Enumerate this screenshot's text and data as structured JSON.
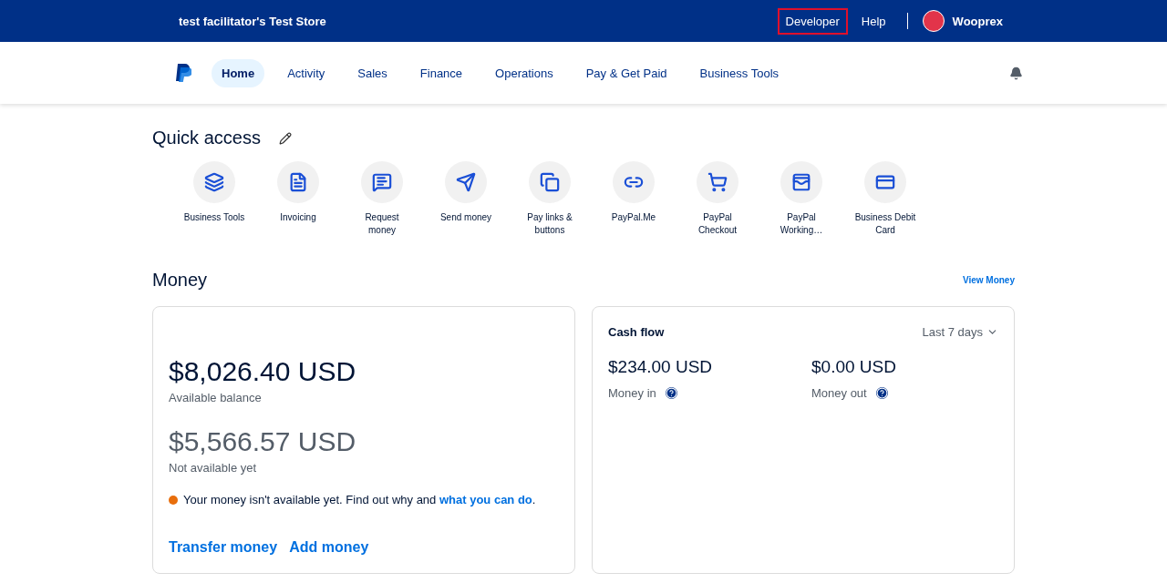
{
  "top_bar": {
    "store_name": "test facilitator's Test Store",
    "links": [
      {
        "label": "Developer",
        "highlighted": true
      },
      {
        "label": "Help",
        "highlighted": false
      }
    ],
    "user": "Wooprex"
  },
  "nav": {
    "items": [
      {
        "label": "Home",
        "selected": true
      },
      {
        "label": "Activity",
        "selected": false
      },
      {
        "label": "Sales",
        "selected": false
      },
      {
        "label": "Finance",
        "selected": false
      },
      {
        "label": "Operations",
        "selected": false
      },
      {
        "label": "Pay & Get Paid",
        "selected": false
      },
      {
        "label": "Business Tools",
        "selected": false
      }
    ]
  },
  "quick_access": {
    "title": "Quick access",
    "items": [
      {
        "label": "Business Tools"
      },
      {
        "label": "Invoicing"
      },
      {
        "label": "Request money"
      },
      {
        "label": "Send money"
      },
      {
        "label": "Pay links & buttons"
      },
      {
        "label": "PayPal.Me"
      },
      {
        "label": "PayPal Checkout"
      },
      {
        "label": "PayPal Working…"
      },
      {
        "label": "Business Debit Card"
      }
    ]
  },
  "money": {
    "title": "Money",
    "view_link": "View Money",
    "balance": {
      "available_amount": "$8,026.40 USD",
      "available_label": "Available balance",
      "pending_amount": "$5,566.57 USD",
      "pending_label": "Not available yet",
      "notice": "Your money isn't available yet. Find out why and ",
      "notice_link": "what you can do",
      "notice_end": ".",
      "actions": [
        "Transfer money",
        "Add money"
      ]
    },
    "cash_flow": {
      "title": "Cash flow",
      "period": "Last 7 days",
      "stats": [
        {
          "amount": "$234.00 USD",
          "label": "Money in"
        },
        {
          "amount": "$0.00 USD",
          "label": "Money out"
        }
      ]
    }
  }
}
